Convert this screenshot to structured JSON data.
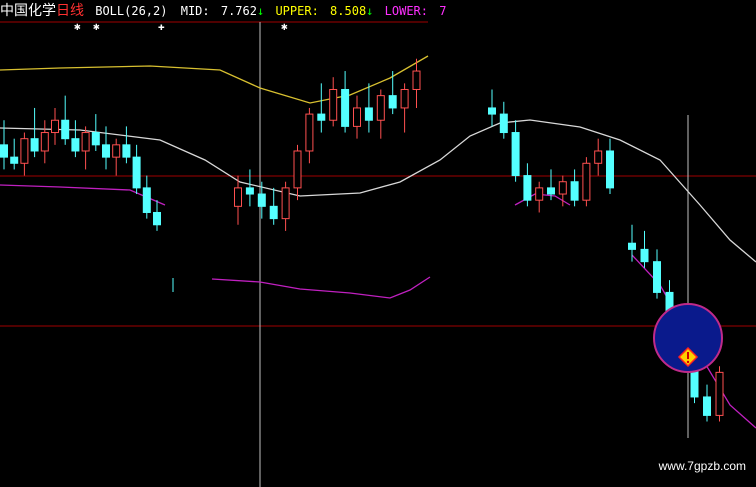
{
  "header": {
    "stock_name": "中国化学",
    "period": "日线",
    "indicator": "BOLL(26,2)",
    "mid_label": "MID:",
    "mid_value": "7.762",
    "mid_arrow": "↓",
    "upper_label": "UPPER:",
    "upper_value": "8.508",
    "upper_arrow": "↓",
    "lower_label": "LOWER:",
    "lower_value": "7",
    "marker_glyph_star": "✱",
    "marker_glyph_plus": "✚"
  },
  "watermark": "www.7gpzb.com",
  "colors": {
    "background": "#000000",
    "up_candle": "#ff5050",
    "down_candle": "#54ffff",
    "mid_line": "#d8d8d8",
    "upper_line": "#d8c030",
    "lower_line": "#c020c0",
    "grid_red": "#a00000",
    "crosshair": "#c0c0c0",
    "highlight_circle_fill": "#0a1a8c",
    "highlight_circle_stroke": "#c02a8a",
    "header_name": "#ffffff",
    "header_period": "#ff3030",
    "header_label": "#ffffff",
    "header_upper": "#ffff00",
    "header_lower": "#ff30ff",
    "arrow_green": "#00ff00"
  },
  "chart_data": {
    "type": "candlestick",
    "indicator": "BOLL(26,2)",
    "series": [
      {
        "name": "MID",
        "last_value": 7.762
      },
      {
        "name": "UPPER",
        "last_value": 8.508
      },
      {
        "name": "LOWER",
        "last_value": 7
      }
    ],
    "candles": [
      {
        "o": 7.8,
        "h": 8.0,
        "l": 7.6,
        "c": 7.7
      },
      {
        "o": 7.7,
        "h": 7.85,
        "l": 7.6,
        "c": 7.65
      },
      {
        "o": 7.65,
        "h": 7.9,
        "l": 7.55,
        "c": 7.85
      },
      {
        "o": 7.85,
        "h": 8.1,
        "l": 7.7,
        "c": 7.75
      },
      {
        "o": 7.75,
        "h": 8.0,
        "l": 7.65,
        "c": 7.9
      },
      {
        "o": 7.9,
        "h": 8.1,
        "l": 7.8,
        "c": 8.0
      },
      {
        "o": 8.0,
        "h": 8.2,
        "l": 7.8,
        "c": 7.85
      },
      {
        "o": 7.85,
        "h": 8.0,
        "l": 7.7,
        "c": 7.75
      },
      {
        "o": 7.75,
        "h": 7.95,
        "l": 7.6,
        "c": 7.9
      },
      {
        "o": 7.9,
        "h": 8.05,
        "l": 7.75,
        "c": 7.8
      },
      {
        "o": 7.8,
        "h": 7.95,
        "l": 7.6,
        "c": 7.7
      },
      {
        "o": 7.7,
        "h": 7.85,
        "l": 7.55,
        "c": 7.8
      },
      {
        "o": 7.8,
        "h": 7.95,
        "l": 7.65,
        "c": 7.7
      },
      {
        "o": 7.7,
        "h": 7.8,
        "l": 7.4,
        "c": 7.45
      },
      {
        "o": 7.45,
        "h": 7.55,
        "l": 7.2,
        "c": 7.25
      },
      {
        "o": 7.25,
        "h": 7.35,
        "l": 7.1,
        "c": 7.15
      },
      {
        "o": 7.3,
        "h": 7.55,
        "l": 7.15,
        "c": 7.45
      },
      {
        "o": 7.45,
        "h": 7.6,
        "l": 7.3,
        "c": 7.4
      },
      {
        "o": 7.4,
        "h": 7.5,
        "l": 7.2,
        "c": 7.3
      },
      {
        "o": 7.3,
        "h": 7.45,
        "l": 7.15,
        "c": 7.2
      },
      {
        "o": 7.2,
        "h": 7.5,
        "l": 7.1,
        "c": 7.45
      },
      {
        "o": 7.45,
        "h": 7.8,
        "l": 7.35,
        "c": 7.75
      },
      {
        "o": 7.75,
        "h": 8.1,
        "l": 7.65,
        "c": 8.05
      },
      {
        "o": 8.05,
        "h": 8.3,
        "l": 7.9,
        "c": 8.0
      },
      {
        "o": 8.0,
        "h": 8.35,
        "l": 7.95,
        "c": 8.25
      },
      {
        "o": 8.25,
        "h": 8.4,
        "l": 7.9,
        "c": 7.95
      },
      {
        "o": 7.95,
        "h": 8.2,
        "l": 7.85,
        "c": 8.1
      },
      {
        "o": 8.1,
        "h": 8.3,
        "l": 7.9,
        "c": 8.0
      },
      {
        "o": 8.0,
        "h": 8.25,
        "l": 7.85,
        "c": 8.2
      },
      {
        "o": 8.2,
        "h": 8.4,
        "l": 8.05,
        "c": 8.1
      },
      {
        "o": 8.1,
        "h": 8.3,
        "l": 7.9,
        "c": 8.25
      },
      {
        "o": 8.25,
        "h": 8.5,
        "l": 8.1,
        "c": 8.4
      },
      {
        "o": 8.1,
        "h": 8.25,
        "l": 7.95,
        "c": 8.05
      },
      {
        "o": 8.05,
        "h": 8.15,
        "l": 7.85,
        "c": 7.9
      },
      {
        "o": 7.9,
        "h": 8.0,
        "l": 7.5,
        "c": 7.55
      },
      {
        "o": 7.55,
        "h": 7.65,
        "l": 7.3,
        "c": 7.35
      },
      {
        "o": 7.35,
        "h": 7.5,
        "l": 7.25,
        "c": 7.45
      },
      {
        "o": 7.45,
        "h": 7.6,
        "l": 7.35,
        "c": 7.4
      },
      {
        "o": 7.4,
        "h": 7.55,
        "l": 7.3,
        "c": 7.5
      },
      {
        "o": 7.5,
        "h": 7.6,
        "l": 7.3,
        "c": 7.35
      },
      {
        "o": 7.35,
        "h": 7.7,
        "l": 7.3,
        "c": 7.65
      },
      {
        "o": 7.65,
        "h": 7.85,
        "l": 7.55,
        "c": 7.75
      },
      {
        "o": 7.75,
        "h": 7.85,
        "l": 7.4,
        "c": 7.45
      },
      {
        "o": 7.0,
        "h": 7.15,
        "l": 6.85,
        "c": 6.95
      },
      {
        "o": 6.95,
        "h": 7.1,
        "l": 6.8,
        "c": 6.85
      },
      {
        "o": 6.85,
        "h": 6.95,
        "l": 6.55,
        "c": 6.6
      },
      {
        "o": 6.6,
        "h": 6.7,
        "l": 6.0,
        "c": 6.05
      },
      {
        "o": 6.05,
        "h": 6.2,
        "l": 5.95,
        "c": 6.15
      },
      {
        "o": 6.15,
        "h": 6.25,
        "l": 5.7,
        "c": 5.75
      },
      {
        "o": 5.75,
        "h": 5.85,
        "l": 5.55,
        "c": 5.6
      },
      {
        "o": 5.6,
        "h": 6.0,
        "l": 5.55,
        "c": 5.95
      }
    ]
  }
}
